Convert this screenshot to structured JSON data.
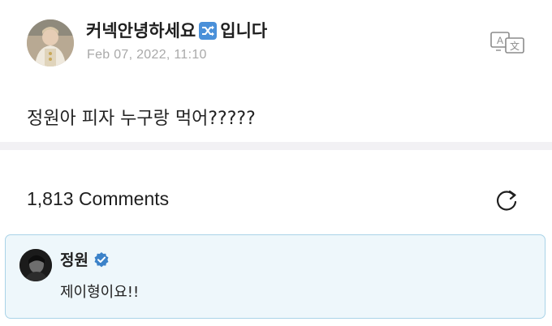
{
  "post": {
    "author_prefix": "커넥안녕하세요",
    "author_emoji": "shuffle-emoji",
    "author_suffix": "입니다",
    "timestamp": "Feb 07, 2022, 11:10",
    "body": "정원아 피자 누구랑 먹어?????",
    "translate_icon": "translate-icon"
  },
  "comments": {
    "count_label": "1,813 Comments",
    "refresh_icon": "refresh-icon"
  },
  "highlighted_comment": {
    "author": "정원",
    "verified_icon": "verified-badge-icon",
    "text": "제이형이요!!"
  },
  "colors": {
    "accent_blue": "#3b82c9",
    "card_bg": "#eef7fb",
    "card_border": "#a9d3e8",
    "divider": "#f2f1f4",
    "muted_text": "#a9a9a9"
  }
}
